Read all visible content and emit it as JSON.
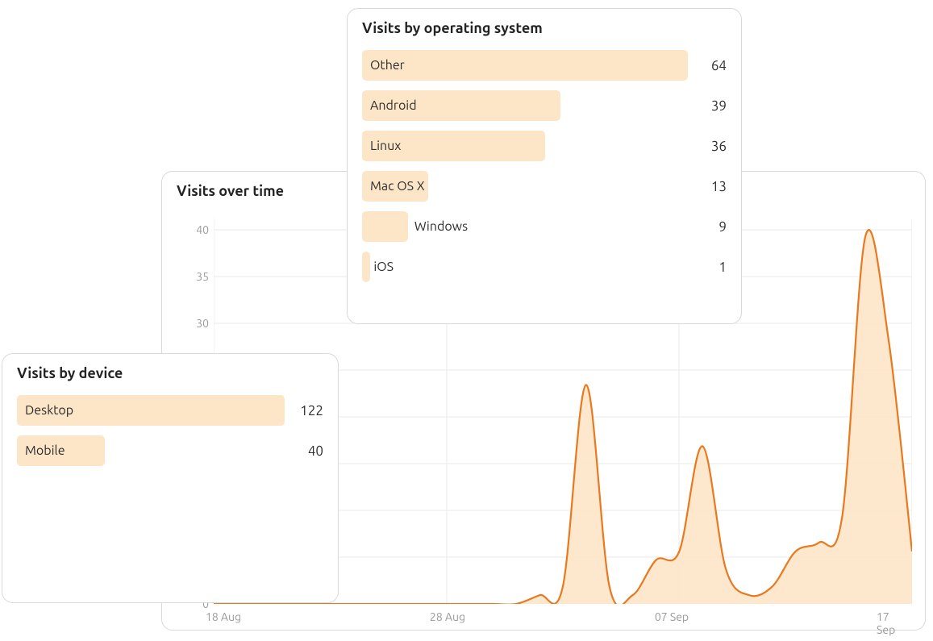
{
  "timeline": {
    "title": "Visits over time",
    "y_ticks": [
      0,
      30,
      35,
      40
    ],
    "x_ticks": [
      "18 Aug",
      "28 Aug",
      "07 Sep",
      "17 Sep"
    ]
  },
  "os": {
    "title": "Visits by operating system",
    "items": [
      {
        "label": "Other",
        "value": 64
      },
      {
        "label": "Android",
        "value": 39
      },
      {
        "label": "Linux",
        "value": 36
      },
      {
        "label": "Mac OS X",
        "value": 13
      },
      {
        "label": "Windows",
        "value": 9
      },
      {
        "label": "iOS",
        "value": 1
      }
    ]
  },
  "device": {
    "title": "Visits by device",
    "items": [
      {
        "label": "Desktop",
        "value": 122
      },
      {
        "label": "Mobile",
        "value": 40
      }
    ]
  },
  "chart_data": [
    {
      "type": "area",
      "title": "Visits over time",
      "xlabel": "",
      "ylabel": "",
      "x_range": [
        "18 Aug",
        "17 Sep"
      ],
      "x_ticks": [
        "18 Aug",
        "28 Aug",
        "07 Sep",
        "17 Sep"
      ],
      "ylim": [
        0,
        44
      ],
      "series": [
        {
          "name": "Visits",
          "x": [
            "18 Aug",
            "19 Aug",
            "20 Aug",
            "21 Aug",
            "22 Aug",
            "23 Aug",
            "24 Aug",
            "25 Aug",
            "26 Aug",
            "27 Aug",
            "28 Aug",
            "29 Aug",
            "30 Aug",
            "31 Aug",
            "01 Sep",
            "02 Sep",
            "03 Sep",
            "04 Sep",
            "05 Sep",
            "06 Sep",
            "07 Sep",
            "08 Sep",
            "09 Sep",
            "10 Sep",
            "11 Sep",
            "12 Sep",
            "13 Sep",
            "14 Sep",
            "15 Sep",
            "16 Sep",
            "17 Sep"
          ],
          "values": [
            0,
            0,
            0,
            0,
            0,
            0,
            0,
            0,
            0,
            0,
            0,
            0,
            0,
            0,
            1,
            2,
            25,
            2,
            1,
            5,
            6,
            18,
            4,
            1,
            2,
            6,
            7,
            10,
            42,
            30,
            6
          ]
        }
      ]
    },
    {
      "type": "bar",
      "title": "Visits by operating system",
      "categories": [
        "Other",
        "Android",
        "Linux",
        "Mac OS X",
        "Windows",
        "iOS"
      ],
      "values": [
        64,
        39,
        36,
        13,
        9,
        1
      ],
      "orientation": "horizontal"
    },
    {
      "type": "bar",
      "title": "Visits by device",
      "categories": [
        "Desktop",
        "Mobile"
      ],
      "values": [
        122,
        40
      ],
      "orientation": "horizontal"
    }
  ]
}
